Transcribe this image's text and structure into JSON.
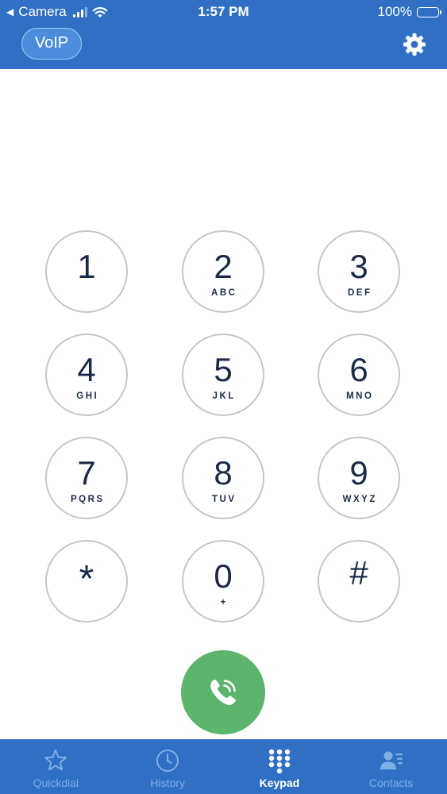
{
  "status_bar": {
    "back_label": "Camera",
    "time": "1:57 PM",
    "battery": "100%"
  },
  "header": {
    "voip_label": "VoIP"
  },
  "keypad": {
    "keys": [
      {
        "digit": "1",
        "letters": ""
      },
      {
        "digit": "2",
        "letters": "ABC"
      },
      {
        "digit": "3",
        "letters": "DEF"
      },
      {
        "digit": "4",
        "letters": "GHI"
      },
      {
        "digit": "5",
        "letters": "JKL"
      },
      {
        "digit": "6",
        "letters": "MNO"
      },
      {
        "digit": "7",
        "letters": "PQRS"
      },
      {
        "digit": "8",
        "letters": "TUV"
      },
      {
        "digit": "9",
        "letters": "WXYZ"
      },
      {
        "digit": "*",
        "letters": ""
      },
      {
        "digit": "0",
        "letters": "+"
      },
      {
        "digit": "#",
        "letters": ""
      }
    ]
  },
  "tabs": [
    {
      "label": "Quickdial",
      "icon": "star-icon"
    },
    {
      "label": "History",
      "icon": "clock-icon"
    },
    {
      "label": "Keypad",
      "icon": "keypad-icon",
      "active": true
    },
    {
      "label": "Contacts",
      "icon": "contacts-icon"
    }
  ],
  "colors": {
    "brand": "#2f6fc4",
    "call": "#5cb46d",
    "key_border": "#c4c7cb",
    "key_text": "#1a2b47",
    "tab_inactive": "#7fb0e6"
  }
}
